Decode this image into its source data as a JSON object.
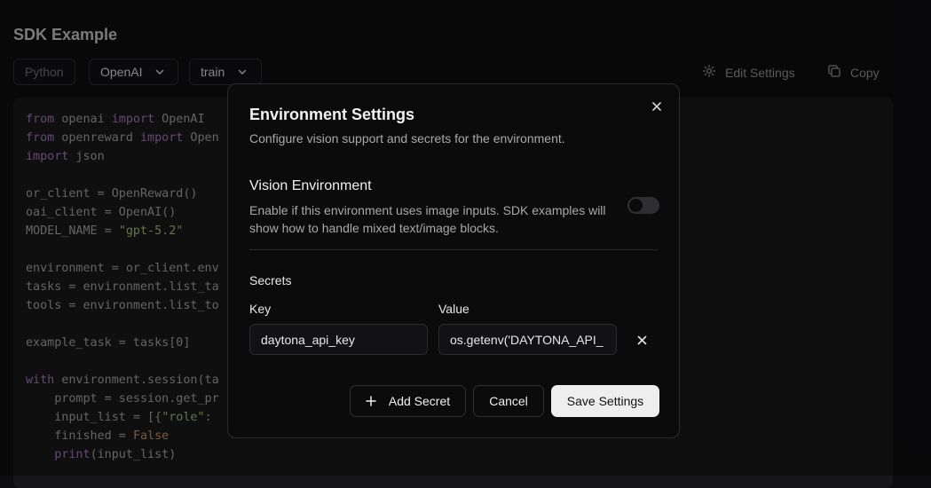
{
  "page": {
    "title": "SDK Example"
  },
  "toolbar": {
    "language": "Python",
    "provider": "OpenAI",
    "split": "train",
    "edit_settings": "Edit Settings",
    "copy": "Copy"
  },
  "code": {
    "lines": [
      [
        {
          "t": "from",
          "c": "kw"
        },
        {
          "t": " openai "
        },
        {
          "t": "import",
          "c": "kw"
        },
        {
          "t": " OpenAI"
        }
      ],
      [
        {
          "t": "from",
          "c": "kw"
        },
        {
          "t": " openreward "
        },
        {
          "t": "import",
          "c": "kw"
        },
        {
          "t": " Open"
        }
      ],
      [
        {
          "t": "import",
          "c": "kw"
        },
        {
          "t": " json"
        }
      ],
      [],
      [
        {
          "t": "or_client = OpenReward()"
        }
      ],
      [
        {
          "t": "oai_client = OpenAI()"
        }
      ],
      [
        {
          "t": "MODEL_NAME = "
        },
        {
          "t": "\"gpt-5.2\"",
          "c": "str"
        }
      ],
      [],
      [
        {
          "t": "environment = or_client.env"
        }
      ],
      [
        {
          "t": "tasks = environment.list_ta"
        }
      ],
      [
        {
          "t": "tools = environment.list_to"
        }
      ],
      [],
      [
        {
          "t": "example_task = tasks[0]"
        }
      ],
      [],
      [
        {
          "t": "with",
          "c": "kw"
        },
        {
          "t": " environment.session(ta"
        }
      ],
      [
        {
          "t": "    prompt = session.get_pr"
        }
      ],
      [
        {
          "t": "    input_list = [{"
        },
        {
          "t": "\"role\"",
          "c": "str"
        },
        {
          "t": ":"
        }
      ],
      [
        {
          "t": "    finished = "
        },
        {
          "t": "False",
          "c": "bool"
        }
      ],
      [
        {
          "t": "    "
        },
        {
          "t": "print",
          "c": "kw"
        },
        {
          "t": "(input_list)"
        }
      ]
    ]
  },
  "modal": {
    "title": "Environment Settings",
    "subtitle": "Configure vision support and secrets for the environment.",
    "vision": {
      "title": "Vision Environment",
      "description": "Enable if this environment uses image inputs. SDK examples will show how to handle mixed text/image blocks.",
      "enabled": false
    },
    "secrets": {
      "title": "Secrets",
      "key_label": "Key",
      "value_label": "Value",
      "rows": [
        {
          "key": "daytona_api_key",
          "value": "os.getenv('DAYTONA_API_"
        }
      ]
    },
    "buttons": {
      "add_secret": "Add Secret",
      "cancel": "Cancel",
      "save": "Save Settings"
    }
  }
}
